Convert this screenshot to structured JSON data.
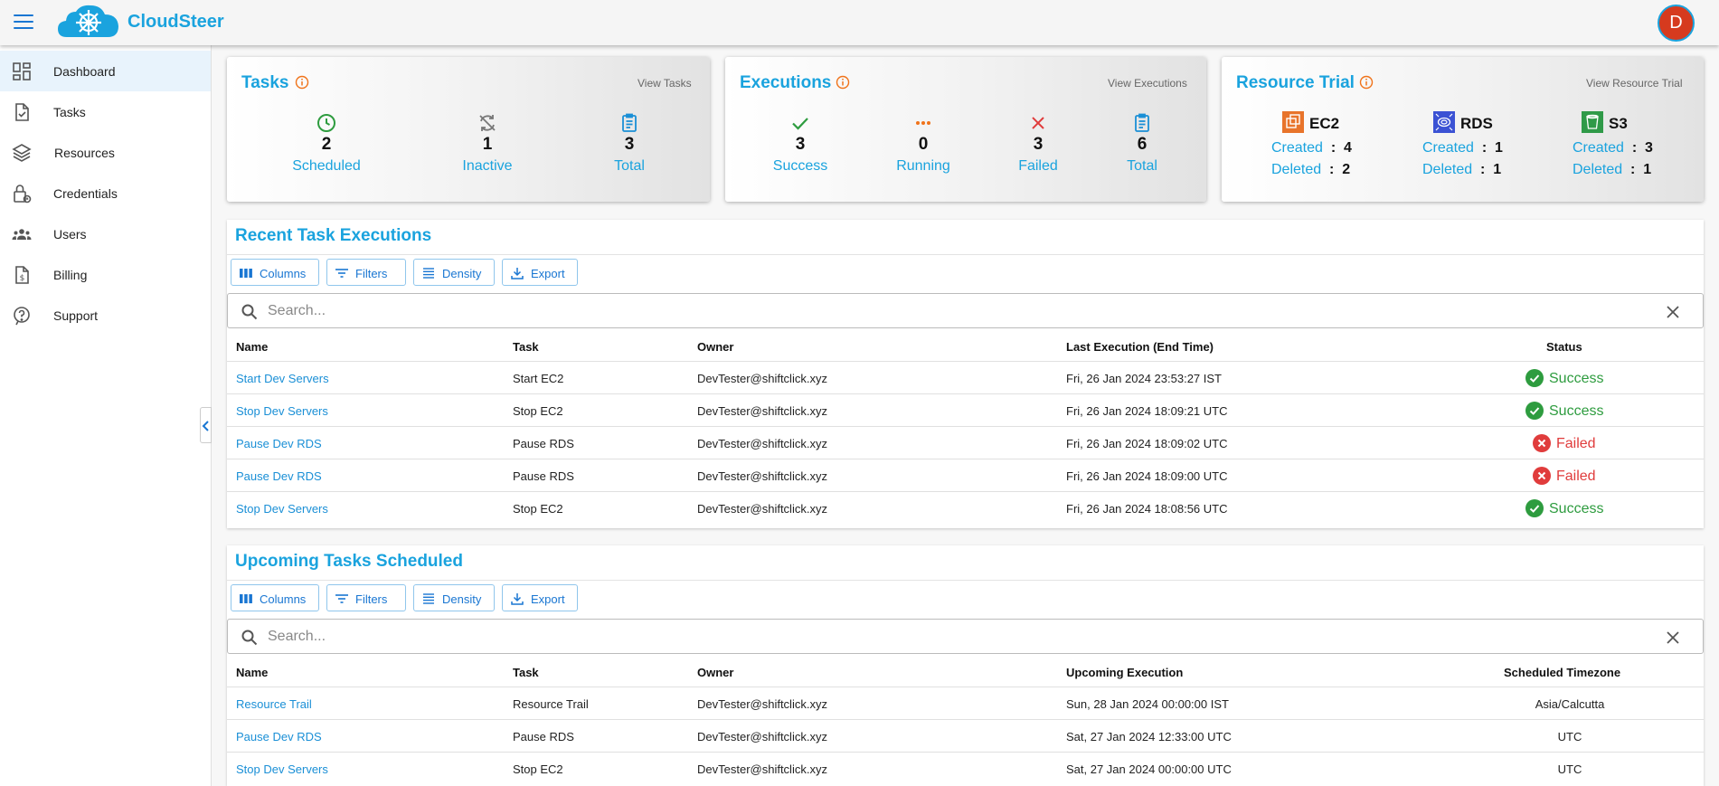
{
  "app": {
    "brand": "CloudSteer",
    "avatar_initial": "D"
  },
  "colors": {
    "accent": "#1aa3de",
    "link": "#1a8fd6",
    "success": "#2e9c3f",
    "failed": "#e03c3c",
    "running": "#f0731a",
    "avatar": "#d63a1e"
  },
  "sidebar": {
    "items": [
      {
        "label": "Dashboard",
        "icon": "dashboard-icon",
        "active": true
      },
      {
        "label": "Tasks",
        "icon": "tasks-icon"
      },
      {
        "label": "Resources",
        "icon": "layers-icon"
      },
      {
        "label": "Credentials",
        "icon": "lock-icon"
      },
      {
        "label": "Users",
        "icon": "users-icon"
      },
      {
        "label": "Billing",
        "icon": "billing-icon"
      },
      {
        "label": "Support",
        "icon": "help-icon"
      }
    ]
  },
  "tasks_card": {
    "title": "Tasks",
    "link": "View Tasks",
    "stats": [
      {
        "value": "2",
        "label": "Scheduled",
        "icon": "clock-icon"
      },
      {
        "value": "1",
        "label": "Inactive",
        "icon": "inactive-sync-icon"
      },
      {
        "value": "3",
        "label": "Total",
        "icon": "clipboard-icon"
      }
    ]
  },
  "executions_card": {
    "title": "Executions",
    "link": "View Executions",
    "stats": [
      {
        "value": "3",
        "label": "Success",
        "icon": "check-icon"
      },
      {
        "value": "0",
        "label": "Running",
        "icon": "dots-icon"
      },
      {
        "value": "3",
        "label": "Failed",
        "icon": "x-icon"
      },
      {
        "value": "6",
        "label": "Total",
        "icon": "clipboard-icon"
      }
    ]
  },
  "resource_card": {
    "title": "Resource Trial",
    "link": "View Resource Trial",
    "created_label": "Created",
    "deleted_label": "Deleted",
    "sep": ":",
    "resources": [
      {
        "name": "EC2",
        "created": "4",
        "deleted": "2",
        "icon": "ec2-icon",
        "color": "#e8742b"
      },
      {
        "name": "RDS",
        "created": "1",
        "deleted": "1",
        "icon": "rds-icon",
        "color": "#3b52d4"
      },
      {
        "name": "S3",
        "created": "3",
        "deleted": "1",
        "icon": "s3-icon",
        "color": "#2f9a48"
      }
    ]
  },
  "toolbar": {
    "columns": "Columns",
    "filters": "Filters",
    "density": "Density",
    "export": "Export"
  },
  "recent": {
    "title": "Recent Task Executions",
    "search_placeholder": "Search...",
    "columns": [
      "Name",
      "Task",
      "Owner",
      "Last Execution (End Time)",
      "Status"
    ],
    "rows": [
      {
        "name": "Start Dev Servers",
        "task": "Start EC2",
        "owner": "DevTester@shiftclick.xyz",
        "time": "Fri, 26 Jan 2024 23:53:27 IST",
        "status": "Success"
      },
      {
        "name": "Stop Dev Servers",
        "task": "Stop EC2",
        "owner": "DevTester@shiftclick.xyz",
        "time": "Fri, 26 Jan 2024 18:09:21 UTC",
        "status": "Success"
      },
      {
        "name": "Pause Dev RDS",
        "task": "Pause RDS",
        "owner": "DevTester@shiftclick.xyz",
        "time": "Fri, 26 Jan 2024 18:09:02 UTC",
        "status": "Failed"
      },
      {
        "name": "Pause Dev RDS",
        "task": "Pause RDS",
        "owner": "DevTester@shiftclick.xyz",
        "time": "Fri, 26 Jan 2024 18:09:00 UTC",
        "status": "Failed"
      },
      {
        "name": "Stop Dev Servers",
        "task": "Stop EC2",
        "owner": "DevTester@shiftclick.xyz",
        "time": "Fri, 26 Jan 2024 18:08:56 UTC",
        "status": "Success"
      }
    ]
  },
  "upcoming": {
    "title": "Upcoming Tasks Scheduled",
    "search_placeholder": "Search...",
    "columns": [
      "Name",
      "Task",
      "Owner",
      "Upcoming Execution",
      "Scheduled Timezone"
    ],
    "rows": [
      {
        "name": "Resource Trail",
        "task": "Resource Trail",
        "owner": "DevTester@shiftclick.xyz",
        "time": "Sun, 28 Jan 2024 00:00:00 IST",
        "tz": "Asia/Calcutta"
      },
      {
        "name": "Pause Dev RDS",
        "task": "Pause RDS",
        "owner": "DevTester@shiftclick.xyz",
        "time": "Sat, 27 Jan 2024 12:33:00 UTC",
        "tz": "UTC"
      },
      {
        "name": "Stop Dev Servers",
        "task": "Stop EC2",
        "owner": "DevTester@shiftclick.xyz",
        "time": "Sat, 27 Jan 2024 00:00:00 UTC",
        "tz": "UTC"
      }
    ]
  }
}
